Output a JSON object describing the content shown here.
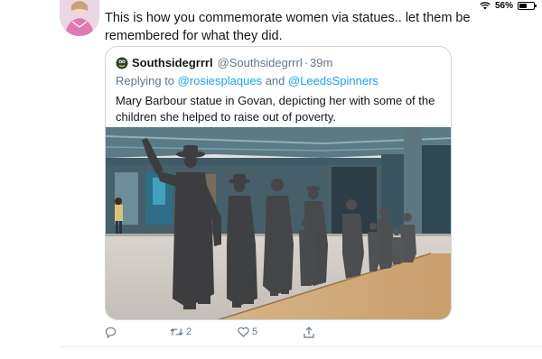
{
  "status_bar": {
    "battery_text": "56%",
    "battery_level": 0.56
  },
  "tweet": {
    "text": "This is how you commemorate women via statues.. let them be remembered for what they did.",
    "actions": {
      "retweets": "2",
      "likes": "5"
    }
  },
  "quote": {
    "name": "Southsidegrrrl",
    "handle": "@Southsidegrrrl",
    "separator": "·",
    "time": "39m",
    "reply_prefix": "Replying to ",
    "reply_user1": "@rosiesplaques",
    "reply_and": " and ",
    "reply_user2": "@LeedsSpinners",
    "text": "Mary Barbour statue in Govan, depicting her with some of the children she helped to raise out of poverty."
  },
  "colors": {
    "link": "#1da1f2",
    "muted": "#657786",
    "text": "#14171a",
    "border": "#ccd6dd"
  },
  "icons": [
    "wifi-icon",
    "battery-icon",
    "reply-icon",
    "retweet-icon",
    "like-icon",
    "share-icon"
  ]
}
